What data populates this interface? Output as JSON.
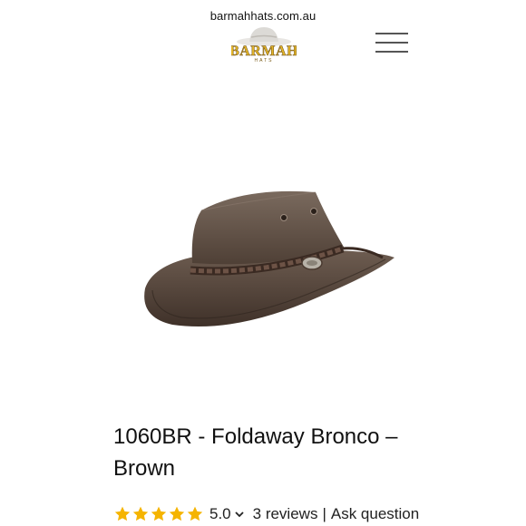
{
  "browser": {
    "url": "barmahhats.com.au"
  },
  "header": {
    "logo_text": "BARMAH",
    "logo_subtext": "HATS",
    "menu_icon": "hamburger-menu-icon"
  },
  "product": {
    "image_icon": "leather-hat-image",
    "title": "1060BR - Foldaway Bronco – Brown",
    "rating": {
      "stars": 5,
      "max_stars": 5,
      "star_color": "#F5B400",
      "score": "5.0",
      "reviews": "3 reviews",
      "separator": "|",
      "ask": "Ask question"
    }
  }
}
